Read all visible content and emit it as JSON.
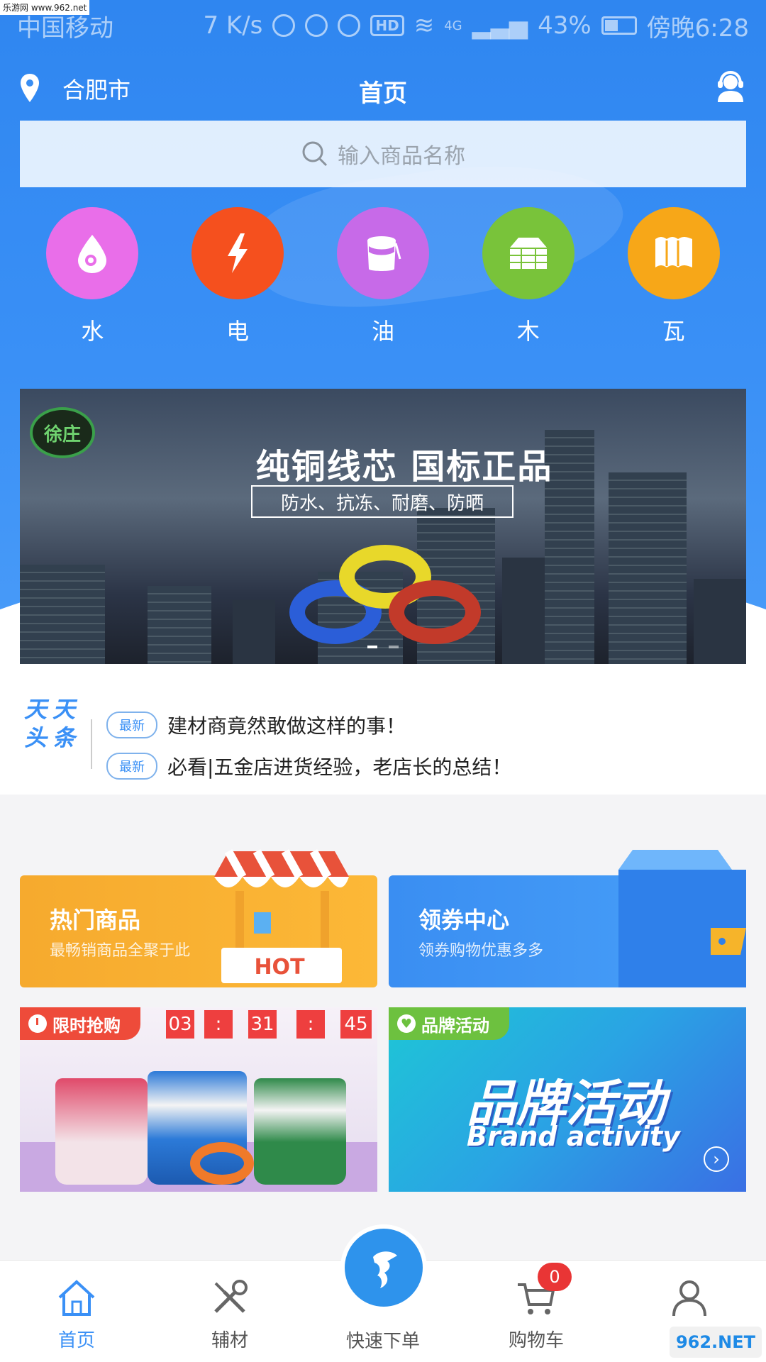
{
  "watermark_top": "乐游网 www.962.net",
  "status_bar": {
    "carrier": "中国移动",
    "speed": "7 K/s",
    "hd": "HD",
    "network": "4G",
    "battery": "43%",
    "time": "傍晚6:28"
  },
  "header": {
    "city": "合肥市",
    "title": "首页"
  },
  "search": {
    "placeholder": "输入商品名称"
  },
  "categories": [
    {
      "label": "水",
      "color": "#e96ee9",
      "icon": "water-drop-icon"
    },
    {
      "label": "电",
      "color": "#f5501e",
      "icon": "lightning-icon"
    },
    {
      "label": "油",
      "color": "#c76ae8",
      "icon": "paint-bucket-icon"
    },
    {
      "label": "木",
      "color": "#79c33a",
      "icon": "wood-planks-icon"
    },
    {
      "label": "瓦",
      "color": "#f7a718",
      "icon": "tile-icon"
    }
  ],
  "banner": {
    "logo_text": "徐庄",
    "title": "纯铜线芯 国标正品",
    "subtitle": "防水、抗冻、耐磨、防晒"
  },
  "headlines": {
    "logo_line1": "天天",
    "logo_line2": "头条",
    "items": [
      {
        "tag": "最新",
        "text": "建材商竟然敢做这样的事！"
      },
      {
        "tag": "最新",
        "text": "必看|五金店进货经验，老店长的总结！"
      }
    ]
  },
  "features": {
    "hot": {
      "title": "热门商品",
      "subtitle": "最畅销商品全聚于此",
      "badge": "HOT"
    },
    "coupon": {
      "title": "领券中心",
      "subtitle": "领券购物优惠多多"
    }
  },
  "flash_sale": {
    "tag": "限时抢购",
    "hours": "03",
    "sep1": ":",
    "minutes": "31",
    "sep2": ":",
    "seconds": "45"
  },
  "brand_activity": {
    "tag": "品牌活动",
    "title_cn": "品牌活动",
    "title_en": "Brand activity"
  },
  "tabbar": {
    "home": "首页",
    "materials": "辅材",
    "quick_order": "快速下单",
    "cart": "购物车",
    "cart_count": "0",
    "profile_label": ""
  },
  "watermark_bottom": "962.NET"
}
